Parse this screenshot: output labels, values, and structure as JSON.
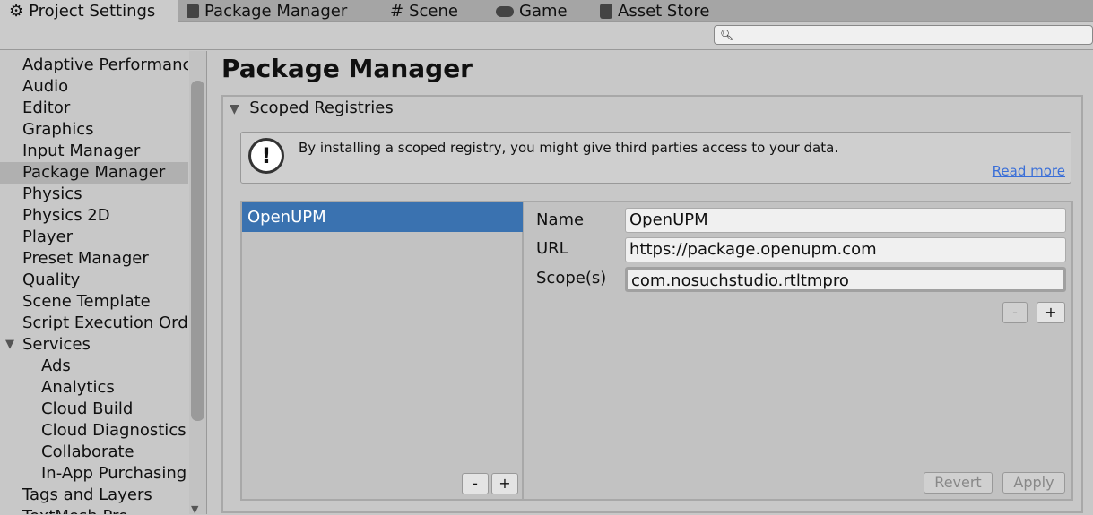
{
  "tabs": [
    {
      "label": "Project Settings",
      "icon": "gear-icon"
    },
    {
      "label": "Package Manager",
      "icon": "package-icon"
    },
    {
      "label": "Scene",
      "icon": "grid-icon"
    },
    {
      "label": "Game",
      "icon": "gamepad-icon"
    },
    {
      "label": "Asset Store",
      "icon": "bag-icon"
    }
  ],
  "search": {
    "icon": "search-icon",
    "value": ""
  },
  "sidebar": {
    "items": [
      "Adaptive Performance",
      "Audio",
      "Editor",
      "Graphics",
      "Input Manager",
      "Package Manager",
      "Physics",
      "Physics 2D",
      "Player",
      "Preset Manager",
      "Quality",
      "Scene Template",
      "Script Execution Order",
      "Services",
      "Ads",
      "Analytics",
      "Cloud Build",
      "Cloud Diagnostics",
      "Collaborate",
      "In-App Purchasing",
      "Tags and Layers",
      "TextMesh Pro"
    ],
    "selected": "Package Manager"
  },
  "main": {
    "title": "Package Manager",
    "section": "Scoped Registries",
    "warning": {
      "text": "By installing a scoped registry, you might give third parties access to your data.",
      "link": "Read more"
    },
    "registries": [
      "OpenUPM"
    ],
    "fields": {
      "name_label": "Name",
      "name": "OpenUPM",
      "url_label": "URL",
      "url": "https://package.openupm.com",
      "scope_label": "Scope(s)",
      "scope": "com.nosuchstudio.rtltmpro"
    },
    "buttons": {
      "minus": "-",
      "plus": "+",
      "revert": "Revert",
      "apply": "Apply"
    }
  },
  "colors": {
    "selection": "#3a72b0",
    "link": "#3a6fd8"
  }
}
